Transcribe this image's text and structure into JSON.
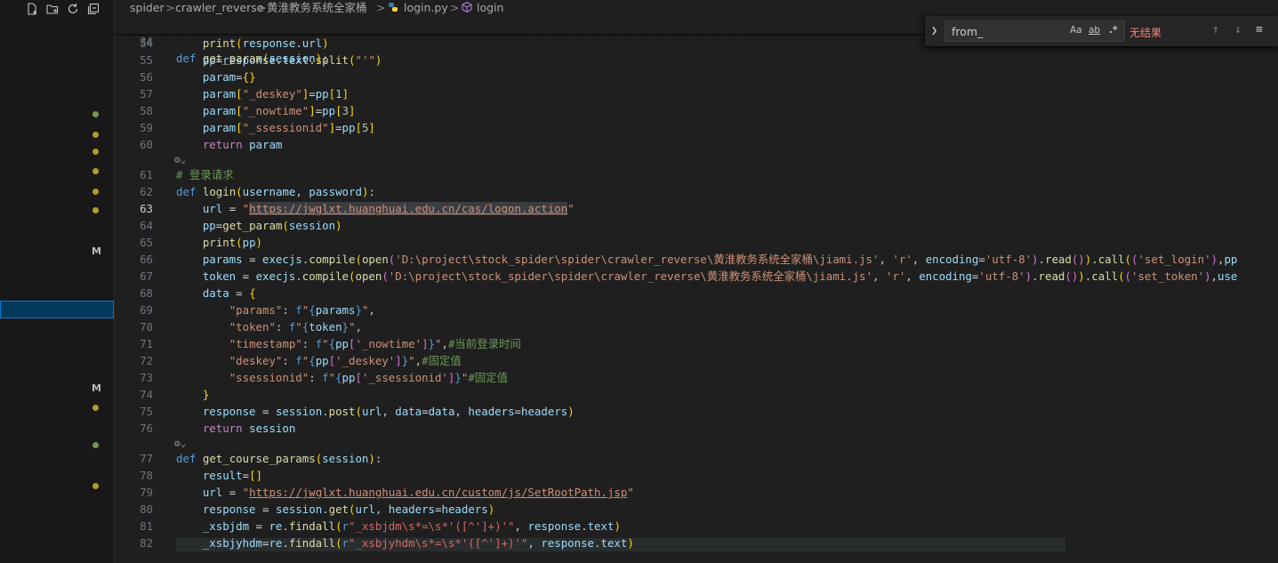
{
  "sidebar": {
    "toolbar_icons": [
      "new-file-icon",
      "new-folder-icon",
      "refresh-icon",
      "collapse-all-icon"
    ],
    "git_markers": [
      {
        "kind": "dot",
        "color": "#6a9955"
      },
      {
        "kind": "dot",
        "color": "#b49c2a"
      },
      {
        "kind": "dot",
        "color": "#b49c2a"
      },
      {
        "kind": "dot",
        "color": "#b49c2a"
      },
      {
        "kind": "dot",
        "color": "#b49c2a"
      },
      {
        "kind": "dot",
        "color": "#b49c2a"
      },
      {
        "kind": "letter",
        "label": "M"
      },
      {
        "kind": "letter",
        "label": "M"
      },
      {
        "kind": "dot",
        "color": "#b49c2a"
      },
      {
        "kind": "dot",
        "color": "#6a9955"
      },
      {
        "kind": "dot",
        "color": "#b49c2a"
      }
    ]
  },
  "breadcrumb": {
    "items": [
      "spider",
      "crawler_reverse",
      "黄淮教务系统全家桶",
      "login.py",
      "login"
    ],
    "separator": ">"
  },
  "find": {
    "value": "from_",
    "options": [
      "Aa",
      "ab",
      "*"
    ],
    "status": "无结果",
    "nav_icons": [
      "arrow-up-icon",
      "arrow-down-icon",
      "menu-icon"
    ]
  },
  "editor": {
    "sticky": {
      "ln": "34",
      "text": "def get_param(session):"
    },
    "active_line": "63",
    "lines": [
      {
        "ln": "54",
        "html": "    <span class='fn'>print</span><span class='br'>(</span><span class='var'>response</span>.<span class='var'>url</span><span class='br'>)</span>"
      },
      {
        "ln": "55",
        "html": "    <span class='var'>pp</span><span class='op'>=</span><span class='var'>response</span>.<span class='var'>text</span>.<span class='fn'>split</span><span class='br'>(</span><span class='str'>\"'\"</span><span class='br'>)</span>"
      },
      {
        "ln": "56",
        "html": "    <span class='var'>param</span><span class='op'>=</span><span class='br'>{}</span>"
      },
      {
        "ln": "57",
        "html": "    <span class='var'>param</span><span class='br'>[</span><span class='str'>\"_deskey\"</span><span class='br'>]</span><span class='op'>=</span><span class='var'>pp</span><span class='br'>[</span><span class='num'>1</span><span class='br'>]</span>"
      },
      {
        "ln": "58",
        "html": "    <span class='var'>param</span><span class='br'>[</span><span class='str'>\"_nowtime\"</span><span class='br'>]</span><span class='op'>=</span><span class='var'>pp</span><span class='br'>[</span><span class='num'>3</span><span class='br'>]</span>"
      },
      {
        "ln": "59",
        "html": "    <span class='var'>param</span><span class='br'>[</span><span class='str'>\"_ssessionid\"</span><span class='br'>]</span><span class='op'>=</span><span class='var'>pp</span><span class='br'>[</span><span class='num'>5</span><span class='br'>]</span>"
      },
      {
        "ln": "60",
        "html": "    <span class='ctl'>return</span> <span class='var'>param</span>"
      },
      {
        "ln": "",
        "html": "",
        "fold": true
      },
      {
        "ln": "61",
        "html": "<span class='cmt'># 登录请求</span>"
      },
      {
        "ln": "62",
        "html": "<span class='kw'>def</span> <span class='fn'>login</span><span class='br'>(</span><span class='var'>username</span>, <span class='var'>password</span><span class='br'>)</span>:"
      },
      {
        "ln": "63",
        "html": "    <span class='var'>url</span> <span class='op'>=</span> <span class='str'>\"<span class='url hl'>https://jwglxt.huanghuai.edu.cn/cas/logon.action</span>\"</span>"
      },
      {
        "ln": "64",
        "html": "    <span class='var'>pp</span><span class='op'>=</span><span class='fn'>get_param</span><span class='br'>(</span><span class='var'>session</span><span class='br'>)</span>"
      },
      {
        "ln": "65",
        "html": "    <span class='fn'>print</span><span class='br'>(</span><span class='var'>pp</span><span class='br'>)</span>"
      },
      {
        "ln": "66",
        "html": "    <span class='var'>params</span> <span class='op'>=</span> <span class='var'>execjs</span>.<span class='fn'>compile</span><span class='br'>(</span><span class='fn'>open</span><span class='br2'>(</span><span class='str'>'D:\\project\\stock_spider\\spider\\crawler_reverse\\黄淮教务系统全家桶\\jiami.js'</span>, <span class='str'>'r'</span>, <span class='var'>encoding</span><span class='op'>=</span><span class='str'>'utf-8'</span><span class='br2'>)</span>.<span class='fn'>read</span><span class='br2'>()</span><span class='br'>)</span>.<span class='fn'>call</span><span class='br'>(</span><span class='br2'>(</span><span class='str'>'set_login'</span><span class='br2'>)</span>,<span class='var'>pp</span>"
      },
      {
        "ln": "67",
        "html": "    <span class='var'>token</span> <span class='op'>=</span> <span class='var'>execjs</span>.<span class='fn'>compile</span><span class='br'>(</span><span class='fn'>open</span><span class='br2'>(</span><span class='str'>'D:\\project\\stock_spider\\spider\\crawler_reverse\\黄淮教务系统全家桶\\jiami.js'</span>, <span class='str'>'r'</span>, <span class='var'>encoding</span><span class='op'>=</span><span class='str'>'utf-8'</span><span class='br2'>)</span>.<span class='fn'>read</span><span class='br2'>()</span><span class='br'>)</span>.<span class='fn'>call</span><span class='br'>(</span><span class='br2'>(</span><span class='str'>'set_token'</span><span class='br2'>)</span>,<span class='var'>use</span>"
      },
      {
        "ln": "68",
        "html": "    <span class='var'>data</span> <span class='op'>=</span> <span class='br'>{</span>"
      },
      {
        "ln": "69",
        "html": "        <span class='str'>\"params\"</span>: <span class='kw'>f</span><span class='str'>\"</span><span class='kw'>{</span><span class='var'>params</span><span class='kw'>}</span><span class='str'>\"</span>,"
      },
      {
        "ln": "70",
        "html": "        <span class='str'>\"token\"</span>: <span class='kw'>f</span><span class='str'>\"</span><span class='kw'>{</span><span class='var'>token</span><span class='kw'>}</span><span class='str'>\"</span>,"
      },
      {
        "ln": "71",
        "html": "        <span class='str'>\"timestamp\"</span>: <span class='kw'>f</span><span class='str'>\"</span><span class='kw'>{</span><span class='var'>pp</span><span class='br2'>[</span><span class='str'>'_nowtime'</span><span class='br2'>]</span><span class='kw'>}</span><span class='str'>\"</span>,<span class='cmt'>#当前登录时间</span>"
      },
      {
        "ln": "72",
        "html": "        <span class='str'>\"deskey\"</span>: <span class='kw'>f</span><span class='str'>\"</span><span class='kw'>{</span><span class='var'>pp</span><span class='br2'>[</span><span class='str'>'_deskey'</span><span class='br2'>]</span><span class='kw'>}</span><span class='str'>\"</span>,<span class='cmt'>#固定值</span>"
      },
      {
        "ln": "73",
        "html": "        <span class='str'>\"ssessionid\"</span>: <span class='kw'>f</span><span class='str'>\"</span><span class='kw'>{</span><span class='var'>pp</span><span class='br2'>[</span><span class='str'>'_ssessionid'</span><span class='br2'>]</span><span class='kw'>}</span><span class='str'>\"</span><span class='cmt'>#固定值</span>"
      },
      {
        "ln": "74",
        "html": "    <span class='br'>}</span>"
      },
      {
        "ln": "75",
        "html": "    <span class='var'>response</span> <span class='op'>=</span> <span class='var'>session</span>.<span class='fn'>post</span><span class='br'>(</span><span class='var'>url</span>, <span class='var'>data</span><span class='op'>=</span><span class='var'>data</span>, <span class='var'>headers</span><span class='op'>=</span><span class='var'>headers</span><span class='br'>)</span>"
      },
      {
        "ln": "76",
        "html": "    <span class='ctl'>return</span> <span class='var'>session</span>"
      },
      {
        "ln": "",
        "html": "",
        "fold": true
      },
      {
        "ln": "77",
        "html": "<span class='kw'>def</span> <span class='fn'>get_course_params</span><span class='br'>(</span><span class='var'>session</span><span class='br'>)</span>:"
      },
      {
        "ln": "78",
        "html": "    <span class='var'>result</span><span class='op'>=</span><span class='br'>[]</span>"
      },
      {
        "ln": "79",
        "html": "    <span class='var'>url</span> <span class='op'>=</span> <span class='str'>\"<span class='url'>https://jwglxt.huanghuai.edu.cn/custom/js/SetRootPath.jsp</span>\"</span>"
      },
      {
        "ln": "80",
        "html": "    <span class='var'>response</span> <span class='op'>=</span> <span class='var'>session</span>.<span class='fn'>get</span><span class='br'>(</span><span class='var'>url</span>, <span class='var'>headers</span><span class='op'>=</span><span class='var'>headers</span><span class='br'>)</span>"
      },
      {
        "ln": "81",
        "html": "    <span class='var'>_xsbjdm</span> <span class='op'>=</span> <span class='var'>re</span>.<span class='fn'>findall</span><span class='br'>(</span><span class='kw'>r</span><span class='re'>\"_xsbjdm\\s*=\\s*'([^']+)'\"</span>, <span class='var'>response</span>.<span class='var'>text</span><span class='br'>)</span>"
      },
      {
        "ln": "82",
        "html": "    <span class='var'>_xsbjyhdm</span><span class='op'>=</span><span class='var'>re</span>.<span class='fn'>findall</span><span class='br'>(</span><span class='kw'>r</span><span class='re'>\"_xsbjyhdm\\s*=\\s*'([^']+)'\"</span>, <span class='var'>response</span>.<span class='var'>text</span><span class='br'>)</span>"
      }
    ]
  }
}
